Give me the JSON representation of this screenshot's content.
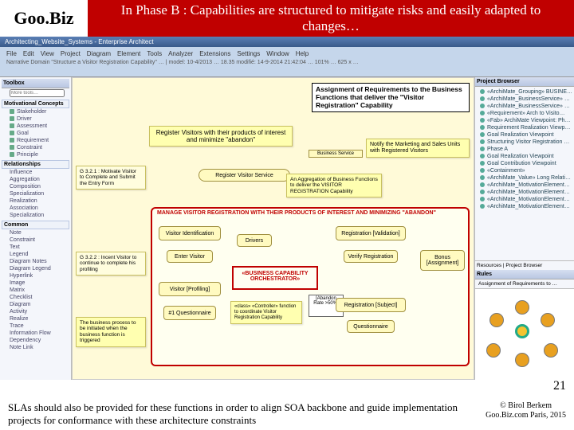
{
  "logo": {
    "goo": "Goo.",
    "biz": "Biz"
  },
  "title": "In Phase B : Capabilities are structured to mitigate risks and easily adapted to changes…",
  "app": {
    "window_title": "Architecting_Website_Systems - Enterprise Architect",
    "menu": [
      "File",
      "Edit",
      "View",
      "Project",
      "Diagram",
      "Element",
      "Tools",
      "Analyzer",
      "Extensions",
      "Settings",
      "Window",
      "Help"
    ],
    "tab": "Narrative Domain \"Structure a Visitor Registration Capability\" … | model: 10-4/2013 … 18.35 modifié: 14-9-2014 21:42:04 … 101% … 625 x …"
  },
  "toolbox": {
    "title": "Toolbox",
    "search_ph": "More tools…",
    "s1": "Motivational Concepts",
    "s1items": [
      "Stakeholder",
      "Driver",
      "Assessment",
      "Goal",
      "Requirement",
      "Constraint",
      "Principle"
    ],
    "s2": "Relationships",
    "s2items": [
      "Influence",
      "Aggregation",
      "Composition",
      "Specialization",
      "Realization",
      "Association",
      "Specialization"
    ],
    "s3": "Common",
    "s3items": [
      "Note",
      "Constraint",
      "Text",
      "Legend",
      "Diagram Notes",
      "Diagram Legend",
      "Hyperlink",
      "Image",
      "Matrix",
      "Checklist",
      "Diagram",
      "Activity",
      "Realize",
      "Trace",
      "Information Flow",
      "Dependency",
      "Note Link"
    ]
  },
  "canvas": {
    "note_main": "Assignment of Requirements to the Business Functions that deliver the \"Visitor Registration\" Capability",
    "sticky_top": "Register Visitors with their products of interest and minimize \"abandon\"",
    "svc_label": "Business Service",
    "sticky_right": "Notify the Marketing and Sales Units with Registered Visitors",
    "sticky_mid": "Register Visitor Service",
    "sticky_agg": "An Aggregation of Business Functions to deliver the VISITOR REGISTRATION Capability",
    "lane_title": "MANAGE VISITOR REGISTRATION WITH THEIR PRODUCTS OF INTEREST AND MINIMIZING \"ABANDON\"",
    "goal1_t": "G 3.2.1 : Motivate Visitor to Complete and Submit the Entry Form",
    "goal2_t": "G 3.2.2 : Incent Visitor to continue to complete his profiling",
    "col1": "Visitor Identification",
    "col1a": "Enter Visitor",
    "col1b": "Visitor [Profiling]",
    "col1c": "#1 Questionnaire",
    "col2a": "Drivers",
    "orch": "«BUSINESS CAPABILITY ORCHESTRATOR»",
    "orch_sub": "«class» «Controller» function to coordinate Visitor Registration Capability",
    "abrate": "[Abandon Rate >50%]",
    "col3": "Registration [Validation]",
    "col3a": "Verify Registration",
    "col3b": "Registration [Subject]",
    "col3c": "Questionnaire",
    "col4": "Bonus [Assignment]",
    "sticky_bl": "The business process to be initiated when the business function is triggered"
  },
  "right": {
    "title": "Project Browser",
    "items": [
      "«ArchiMate_Grouping» BUSINES…",
      "«ArchiMate_BusinessService» Re…",
      "«ArchiMate_BusinessService» Reg…",
      "«Requirement» Arch to Visito…",
      "«Fab» ArchiMate Viewpoint: Phase A",
      "Requirement Realization Viewpoi…",
      "Goal Realization Viewpoint",
      "Structuring Visitor Registration C…",
      "Phase A",
      "Goal Realization Viewpoint",
      "Goal Contribution Viewpoint",
      "«Containment»",
      "«ArchiMate_Value» Long Relationsh…",
      "«ArchiMate_MotivationElement» G1.0 M…",
      "«ArchiMate_MotivationElement» G3.2.1…",
      "«ArchiMate_MotivationElement» G1.0 L…",
      "«ArchiMate_MotivationElement» G1.0 S…"
    ],
    "tabs": "Resources | Project Browser",
    "rules": "Rules",
    "rules_sub": "Assignment of Requirements to …"
  },
  "footer": {
    "main": "SLAs should also be provided for these functions in order to align SOA backbone and guide implementation projects for conformance with these architecture constraints",
    "c1": "© Birol Berkem",
    "c2": "Goo.Biz.com Paris, 2015",
    "page": "21"
  }
}
